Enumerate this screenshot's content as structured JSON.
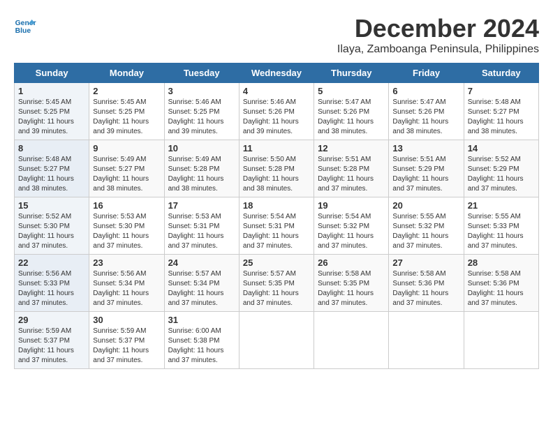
{
  "header": {
    "logo_line1": "General",
    "logo_line2": "Blue",
    "title": "December 2024",
    "subtitle": "Ilaya, Zamboanga Peninsula, Philippines"
  },
  "weekdays": [
    "Sunday",
    "Monday",
    "Tuesday",
    "Wednesday",
    "Thursday",
    "Friday",
    "Saturday"
  ],
  "weeks": [
    [
      {
        "day": 1,
        "rise": "5:45 AM",
        "set": "5:25 PM",
        "hours": "11 hours and 39 minutes."
      },
      {
        "day": 2,
        "rise": "5:45 AM",
        "set": "5:25 PM",
        "hours": "11 hours and 39 minutes."
      },
      {
        "day": 3,
        "rise": "5:46 AM",
        "set": "5:25 PM",
        "hours": "11 hours and 39 minutes."
      },
      {
        "day": 4,
        "rise": "5:46 AM",
        "set": "5:26 PM",
        "hours": "11 hours and 39 minutes."
      },
      {
        "day": 5,
        "rise": "5:47 AM",
        "set": "5:26 PM",
        "hours": "11 hours and 38 minutes."
      },
      {
        "day": 6,
        "rise": "5:47 AM",
        "set": "5:26 PM",
        "hours": "11 hours and 38 minutes."
      },
      {
        "day": 7,
        "rise": "5:48 AM",
        "set": "5:27 PM",
        "hours": "11 hours and 38 minutes."
      }
    ],
    [
      {
        "day": 8,
        "rise": "5:48 AM",
        "set": "5:27 PM",
        "hours": "11 hours and 38 minutes."
      },
      {
        "day": 9,
        "rise": "5:49 AM",
        "set": "5:27 PM",
        "hours": "11 hours and 38 minutes."
      },
      {
        "day": 10,
        "rise": "5:49 AM",
        "set": "5:28 PM",
        "hours": "11 hours and 38 minutes."
      },
      {
        "day": 11,
        "rise": "5:50 AM",
        "set": "5:28 PM",
        "hours": "11 hours and 38 minutes."
      },
      {
        "day": 12,
        "rise": "5:51 AM",
        "set": "5:28 PM",
        "hours": "11 hours and 37 minutes."
      },
      {
        "day": 13,
        "rise": "5:51 AM",
        "set": "5:29 PM",
        "hours": "11 hours and 37 minutes."
      },
      {
        "day": 14,
        "rise": "5:52 AM",
        "set": "5:29 PM",
        "hours": "11 hours and 37 minutes."
      }
    ],
    [
      {
        "day": 15,
        "rise": "5:52 AM",
        "set": "5:30 PM",
        "hours": "11 hours and 37 minutes."
      },
      {
        "day": 16,
        "rise": "5:53 AM",
        "set": "5:30 PM",
        "hours": "11 hours and 37 minutes."
      },
      {
        "day": 17,
        "rise": "5:53 AM",
        "set": "5:31 PM",
        "hours": "11 hours and 37 minutes."
      },
      {
        "day": 18,
        "rise": "5:54 AM",
        "set": "5:31 PM",
        "hours": "11 hours and 37 minutes."
      },
      {
        "day": 19,
        "rise": "5:54 AM",
        "set": "5:32 PM",
        "hours": "11 hours and 37 minutes."
      },
      {
        "day": 20,
        "rise": "5:55 AM",
        "set": "5:32 PM",
        "hours": "11 hours and 37 minutes."
      },
      {
        "day": 21,
        "rise": "5:55 AM",
        "set": "5:33 PM",
        "hours": "11 hours and 37 minutes."
      }
    ],
    [
      {
        "day": 22,
        "rise": "5:56 AM",
        "set": "5:33 PM",
        "hours": "11 hours and 37 minutes."
      },
      {
        "day": 23,
        "rise": "5:56 AM",
        "set": "5:34 PM",
        "hours": "11 hours and 37 minutes."
      },
      {
        "day": 24,
        "rise": "5:57 AM",
        "set": "5:34 PM",
        "hours": "11 hours and 37 minutes."
      },
      {
        "day": 25,
        "rise": "5:57 AM",
        "set": "5:35 PM",
        "hours": "11 hours and 37 minutes."
      },
      {
        "day": 26,
        "rise": "5:58 AM",
        "set": "5:35 PM",
        "hours": "11 hours and 37 minutes."
      },
      {
        "day": 27,
        "rise": "5:58 AM",
        "set": "5:36 PM",
        "hours": "11 hours and 37 minutes."
      },
      {
        "day": 28,
        "rise": "5:58 AM",
        "set": "5:36 PM",
        "hours": "11 hours and 37 minutes."
      }
    ],
    [
      {
        "day": 29,
        "rise": "5:59 AM",
        "set": "5:37 PM",
        "hours": "11 hours and 37 minutes."
      },
      {
        "day": 30,
        "rise": "5:59 AM",
        "set": "5:37 PM",
        "hours": "11 hours and 37 minutes."
      },
      {
        "day": 31,
        "rise": "6:00 AM",
        "set": "5:38 PM",
        "hours": "11 hours and 37 minutes."
      },
      null,
      null,
      null,
      null
    ]
  ],
  "labels": {
    "sunrise": "Sunrise:",
    "sunset": "Sunset:",
    "daylight": "Daylight:"
  }
}
